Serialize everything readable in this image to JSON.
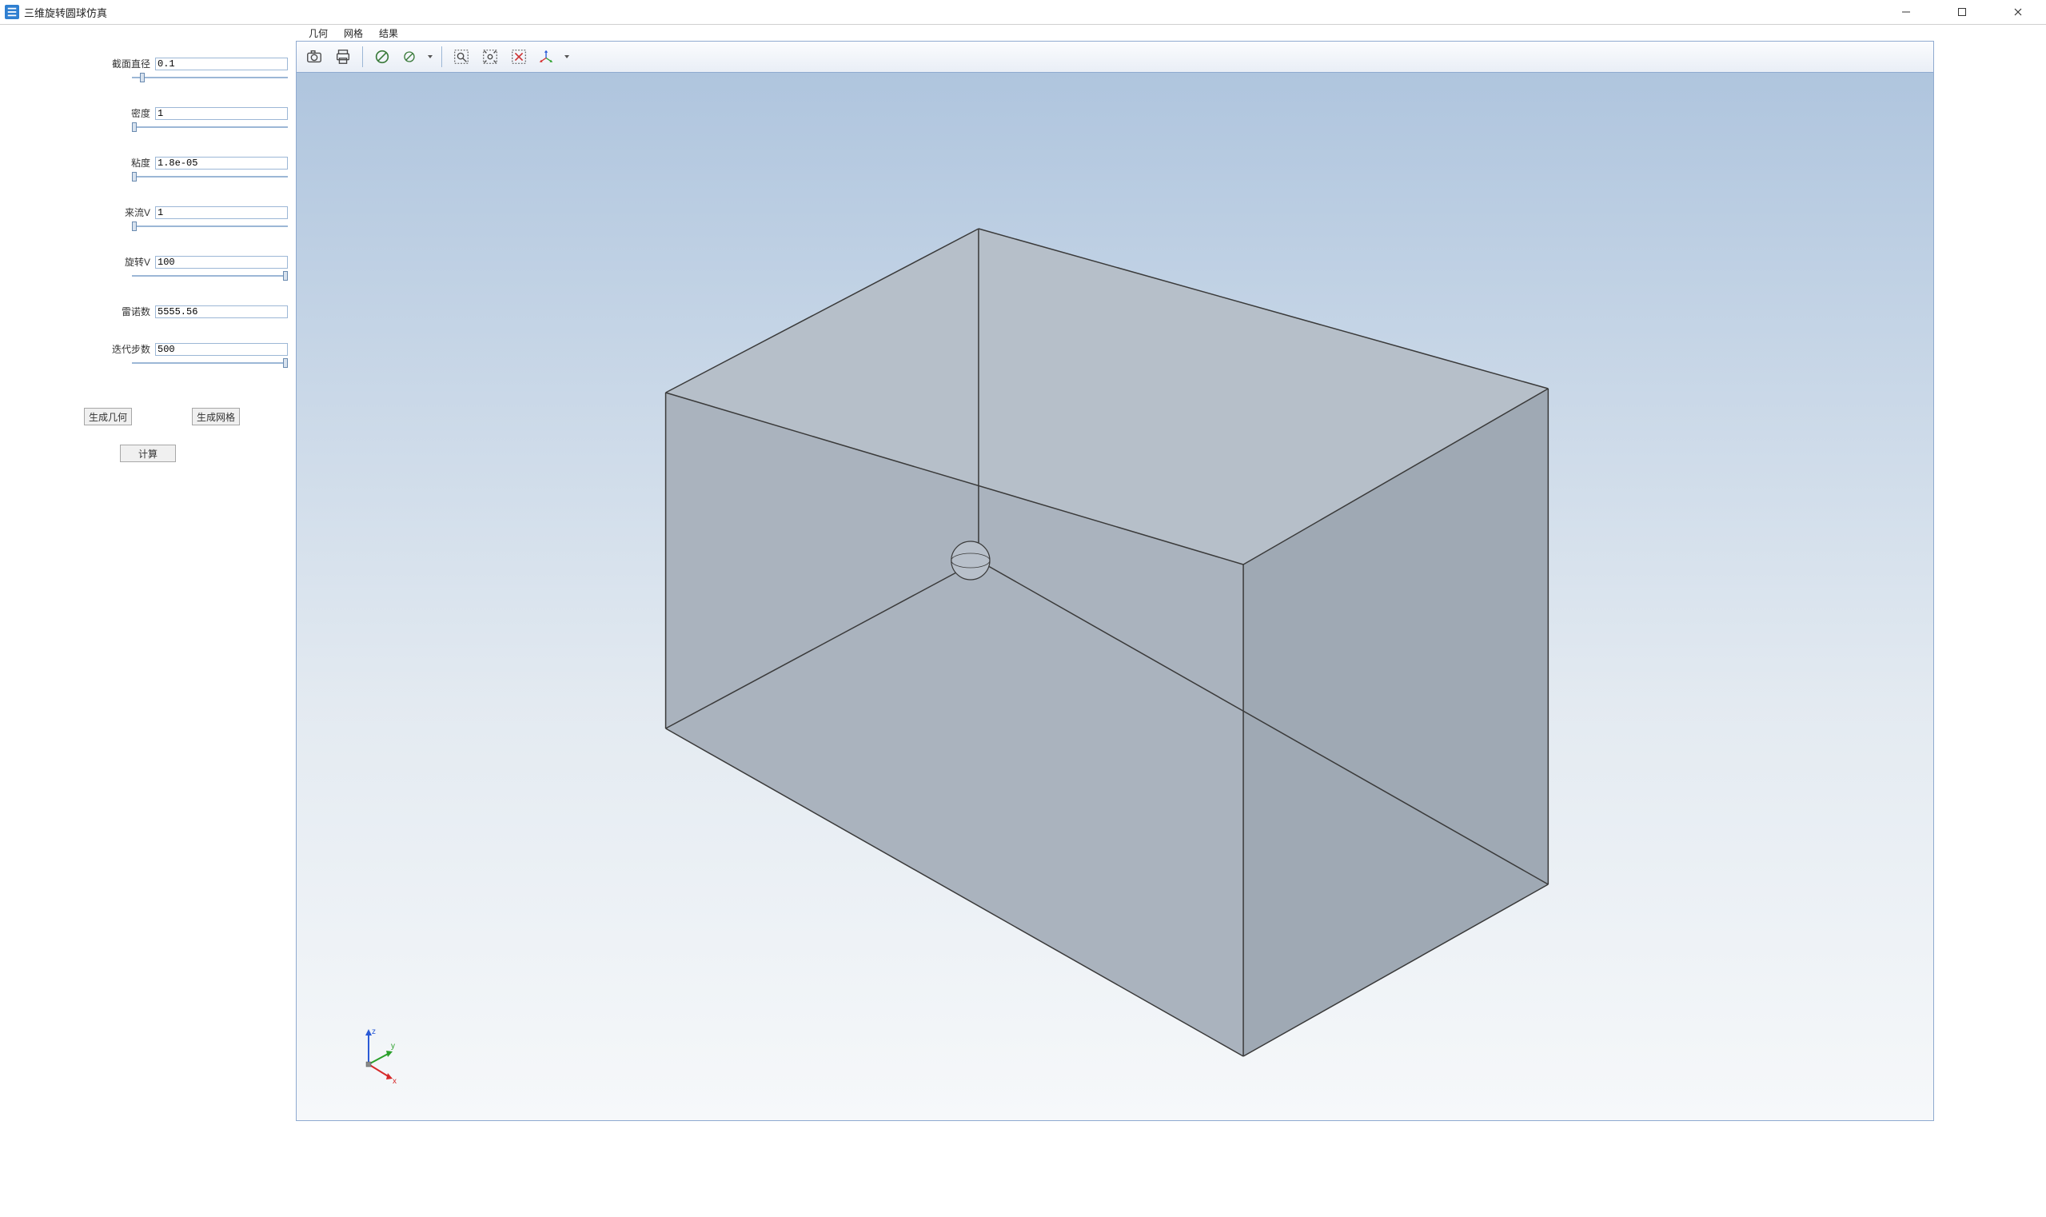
{
  "window": {
    "title": "三维旋转圆球仿真"
  },
  "menu": {
    "items": [
      "几何",
      "网格",
      "结果"
    ]
  },
  "toolbar": {
    "icons": [
      "camera-icon",
      "print-icon",
      "sep",
      "forbid-icon",
      "forbid-dropdown",
      "sep",
      "zoom-window-icon",
      "zoom-extents-icon",
      "zoom-clear-icon",
      "axis-dropdown-icon"
    ]
  },
  "params": [
    {
      "label": "截面直径",
      "value": "0.1",
      "thumb": 0.05
    },
    {
      "label": "密度",
      "value": "1",
      "thumb": 0.0
    },
    {
      "label": "粘度",
      "value": "1.8e-05",
      "thumb": 0.0
    },
    {
      "label": "来流V",
      "value": "1",
      "thumb": 0.0
    },
    {
      "label": "旋转V",
      "value": "100",
      "thumb": 1.0
    },
    {
      "label": "雷诺数",
      "value": "5555.56",
      "thumb": null
    },
    {
      "label": "迭代步数",
      "value": "500",
      "thumb": 1.0
    }
  ],
  "buttons": {
    "gen_geom": "生成几何",
    "gen_mesh": "生成网格",
    "compute": "计算"
  },
  "triad": {
    "x": "x",
    "y": "y",
    "z": "z"
  }
}
